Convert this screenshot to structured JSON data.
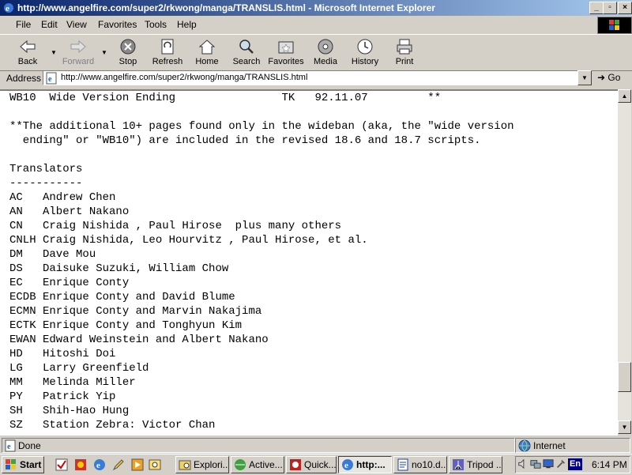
{
  "window": {
    "title": "http://www.angelfire.com/super2/rkwong/manga/TRANSLIS.html - Microsoft Internet Explorer",
    "minimize_label": "_",
    "maximize_label": "▫",
    "close_label": "×"
  },
  "menu": {
    "items": [
      {
        "label": "File"
      },
      {
        "label": "Edit"
      },
      {
        "label": "View"
      },
      {
        "label": "Favorites"
      },
      {
        "label": "Tools"
      },
      {
        "label": "Help"
      }
    ]
  },
  "toolbar": {
    "back": "Back",
    "forward": "Forward",
    "stop": "Stop",
    "refresh": "Refresh",
    "home": "Home",
    "search": "Search",
    "favorites": "Favorites",
    "media": "Media",
    "history": "History",
    "print": "Print"
  },
  "address": {
    "label": "Address",
    "url": "http://www.angelfire.com/super2/rkwong/manga/TRANSLIS.html",
    "go": "Go"
  },
  "content": {
    "lines": [
      "WB10  Wide Version Ending                TK   92.11.07         **",
      "",
      "**The additional 10+ pages found only in the wideban (aka, the \"wide version",
      "  ending\" or \"WB10\") are included in the revised 18.6 and 18.7 scripts.",
      "",
      "Translators",
      "-----------",
      "AC   Andrew Chen",
      "AN   Albert Nakano",
      "CN   Craig Nishida , Paul Hirose  plus many others",
      "CNLH Craig Nishida, Leo Hourvitz , Paul Hirose, et al.",
      "DM   Dave Mou",
      "DS   Daisuke Suzuki, William Chow",
      "EC   Enrique Conty",
      "ECDB Enrique Conty and David Blume",
      "ECMN Enrique Conty and Marvin Nakajima",
      "ECTK Enrique Conty and Tonghyun Kim",
      "EWAN Edward Weinstein and Albert Nakano",
      "HD   Hitoshi Doi",
      "LG   Larry Greenfield",
      "MM   Melinda Miller",
      "PY   Patrick Yip",
      "SH   Shih-Hao Hung",
      "SZ   Station Zebra: Victor Chan"
    ]
  },
  "status": {
    "left": "Done",
    "zone": "Internet"
  },
  "taskbar": {
    "start": "Start",
    "tasks": [
      {
        "label": "Explori..."
      },
      {
        "label": "Active..."
      },
      {
        "label": "Quick..."
      },
      {
        "label": "http:..."
      },
      {
        "label": "no10.d..."
      },
      {
        "label": "Tripod ..."
      }
    ],
    "lang": "En",
    "clock": "6:14 PM"
  }
}
